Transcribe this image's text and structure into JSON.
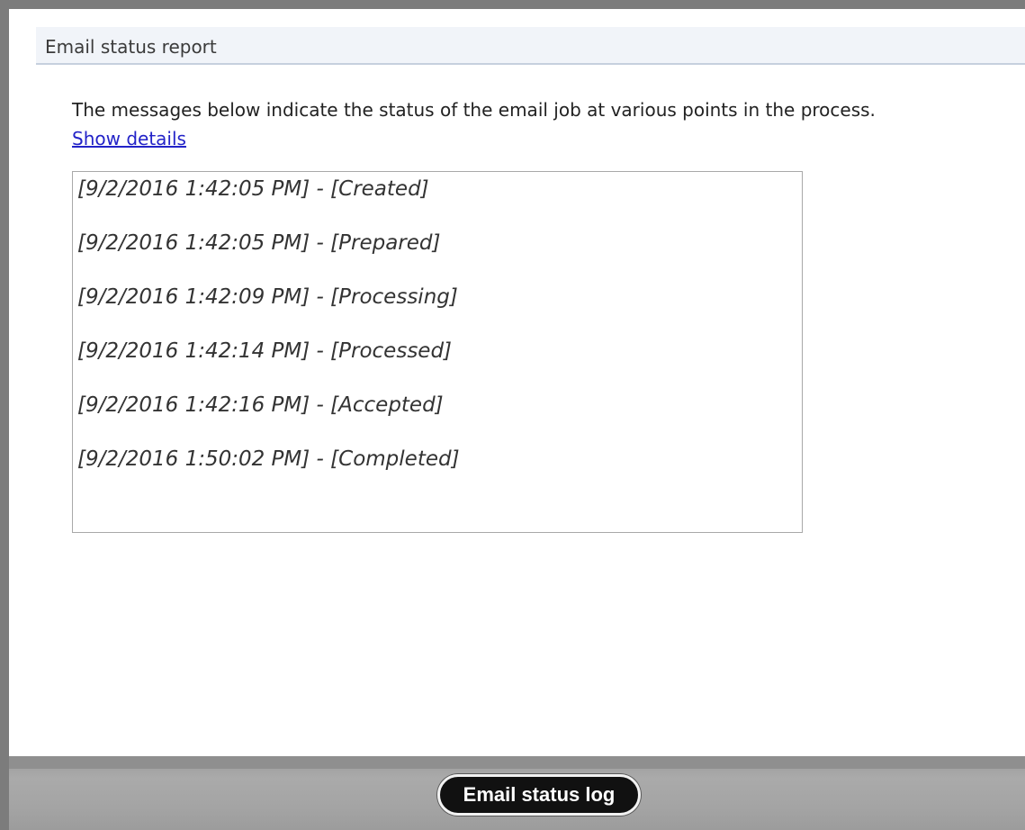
{
  "panel": {
    "title": "Email status report"
  },
  "intro_text": "The messages below indicate the status of the email job at various points in the process.",
  "show_details_link": "Show details",
  "log": {
    "entries": [
      "[9/2/2016 1:42:05 PM] - [Created]",
      "[9/2/2016 1:42:05 PM] - [Prepared]",
      "[9/2/2016 1:42:09 PM] - [Processing]",
      "[9/2/2016 1:42:14 PM] - [Processed]",
      "[9/2/2016 1:42:16 PM] - [Accepted]",
      "[9/2/2016 1:50:02 PM] - [Completed]"
    ]
  },
  "bottom_bar": {
    "button_label": "Email status log"
  },
  "colors": {
    "link": "#2323c8",
    "frame": "#7c7c7c",
    "header_bg": "#f1f4f9",
    "button_bg": "#111111"
  }
}
